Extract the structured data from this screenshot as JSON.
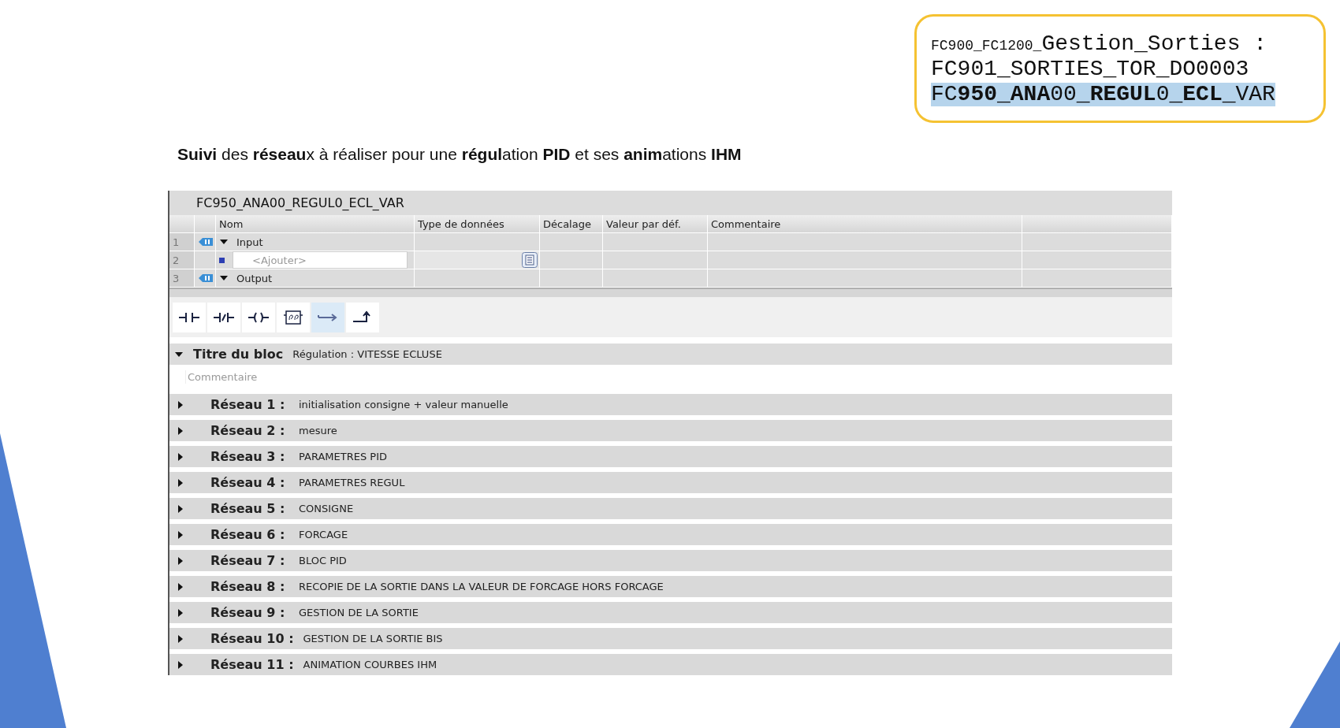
{
  "callout": {
    "lines": [
      {
        "small": "FC900_FC1200_",
        "text": "Gestion_Sorties :",
        "highlighted": false
      },
      {
        "text": "FC901_SORTIES_TOR_DO0003",
        "highlighted": false
      },
      {
        "text": "FC**950_ANA**00**_REGUL**0**_ECL**_VAR",
        "highlighted": true
      }
    ]
  },
  "headline": "**Suivi** des **réseau**x à réaliser pour une **régul**ation **PID** et ses **anim**ations **IHM**",
  "editor": {
    "title": "FC950_ANA00_REGUL0_ECL_VAR",
    "columns": [
      "Nom",
      "Type de données",
      "Décalage",
      "Valeur par déf.",
      "Commentaire"
    ],
    "rows": [
      {
        "number": "1",
        "kind": "section",
        "name": "Input",
        "expanded": true
      },
      {
        "number": "2",
        "kind": "add",
        "placeholder": "<Ajouter>"
      },
      {
        "number": "3",
        "kind": "section",
        "name": "Output",
        "expanded": true
      }
    ],
    "toolbar": [
      {
        "kind": "no-contact",
        "selected": false
      },
      {
        "kind": "nc-contact",
        "selected": false
      },
      {
        "kind": "coil",
        "selected": false
      },
      {
        "kind": "empty-box",
        "selected": false
      },
      {
        "kind": "open-branch",
        "selected": true
      },
      {
        "kind": "close-branch",
        "selected": false
      }
    ],
    "block": {
      "label": "Titre du bloc",
      "value": "Régulation : VITESSE ECLUSE",
      "expanded": true,
      "placeholder": "Commentaire"
    },
    "networks": [
      {
        "label": "Réseau 1 :",
        "title": "initialisation consigne + valeur manuelle",
        "expanded": false
      },
      {
        "label": "Réseau 2 :",
        "title": "mesure",
        "expanded": false
      },
      {
        "label": "Réseau 3 :",
        "title": "PARAMETRES PID",
        "expanded": false
      },
      {
        "label": "Réseau 4 :",
        "title": "PARAMETRES REGUL",
        "expanded": false
      },
      {
        "label": "Réseau 5 :",
        "title": "CONSIGNE",
        "expanded": false
      },
      {
        "label": "Réseau 6 :",
        "title": "FORCAGE",
        "expanded": false
      },
      {
        "label": "Réseau 7 :",
        "title": "BLOC PID",
        "expanded": false
      },
      {
        "label": "Réseau 8 :",
        "title": "RECOPIE DE LA SORTIE DANS LA VALEUR DE FORCAGE HORS FORCAGE",
        "expanded": false
      },
      {
        "label": "Réseau 9 :",
        "title": "GESTION DE LA SORTIE",
        "expanded": false
      },
      {
        "label": "Réseau 10 :",
        "title": "GESTION DE LA SORTIE BIS",
        "expanded": false
      },
      {
        "label": "Réseau 11 :",
        "title": "ANIMATION COURBES IHM",
        "expanded": false
      }
    ]
  }
}
